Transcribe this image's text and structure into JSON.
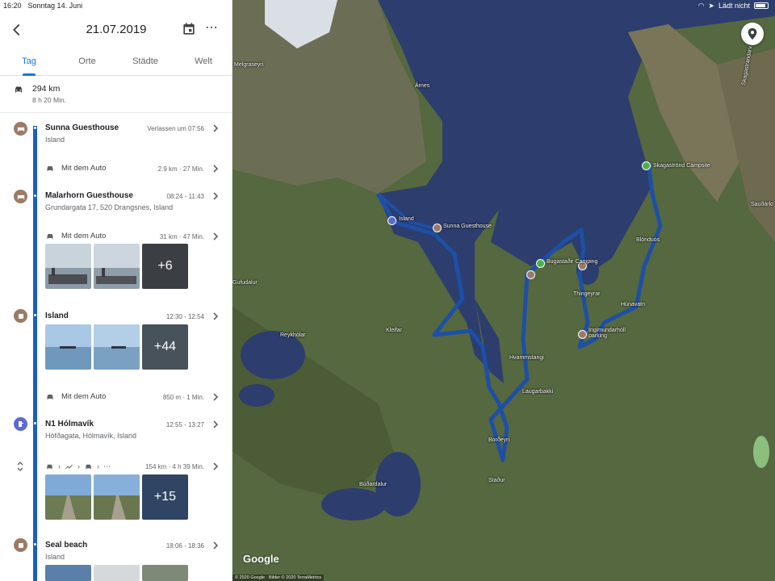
{
  "status_bar": {
    "time": "16:20",
    "date": "Sonntag 14. Juni",
    "network": "Lädt nicht"
  },
  "header": {
    "date": "21.07.2019"
  },
  "tabs": [
    {
      "label": "Tag"
    },
    {
      "label": "Orte"
    },
    {
      "label": "Städte"
    },
    {
      "label": "Welt"
    }
  ],
  "summary": {
    "distance": "294 km",
    "duration": "8 h 20 Min."
  },
  "timeline": {
    "stop1": {
      "title": "Sunna Guesthouse",
      "subtitle": "Island",
      "time": "Verlassen um 07:56"
    },
    "seg1": {
      "label": "Mit dem Auto",
      "meta": "2.9 km · 27 Min."
    },
    "stop2": {
      "title": "Malarhorn Guesthouse",
      "subtitle": "Grundargata 17, 520 Drangsnes, Island",
      "time": "08:24 - 11:43"
    },
    "seg2": {
      "label": "Mit dem Auto",
      "meta": "31 km · 47 Min.",
      "more_photos": "+6"
    },
    "stop3": {
      "title": "Island",
      "time": "12:30 - 12:54",
      "more_photos": "+44"
    },
    "seg3": {
      "label": "Mit dem Auto",
      "meta": "850 m · 1 Min."
    },
    "stop4": {
      "title": "N1 Hólmavík",
      "subtitle": "Höfðagata, Hólmavík, Island",
      "time": "12:55 - 13:27"
    },
    "seg4": {
      "meta": "154 km · 4 h 39 Min.",
      "more_photos": "+15"
    },
    "stop5": {
      "title": "Seal beach",
      "subtitle": "Island",
      "time": "18:06 - 18:36"
    }
  },
  "map": {
    "labels": {
      "melgraseyri": "Melgraseyri",
      "arnes": "Árnes",
      "gufudalur": "Gufudalur",
      "reykholar": "Reykhólar",
      "kleifar": "Kleifar",
      "island_pin": "Island",
      "sunna_pin": "Sunna Guesthouse",
      "bugastadir": "Bugastaðir Camping",
      "thingeyrar": "Thingeyrar",
      "ingimundarholl": "Ingimundarhóll parking",
      "hvammstangi": "Hvammstangi",
      "laugarbakki": "Laugarbakki",
      "bordeyri": "Borðeyri",
      "stadur": "Staður",
      "budardalur": "Búðardalur",
      "skagastrond": "Skagaströnd Campsite",
      "blonduos": "Blönduós",
      "hunavatn": "Húnavatn",
      "saudark": "Sauðárkr",
      "skagastrond_road": "Skagastrandarv."
    },
    "google": "Google",
    "copyright": "© 2020 Google · Bilder © 2020 TerraMetrics"
  },
  "colors": {
    "accent": "#1a73e8",
    "route": "#1a5fbf",
    "stop": "#9c7a66",
    "fuel": "#5b6bcf",
    "camp": "#4caf50"
  }
}
